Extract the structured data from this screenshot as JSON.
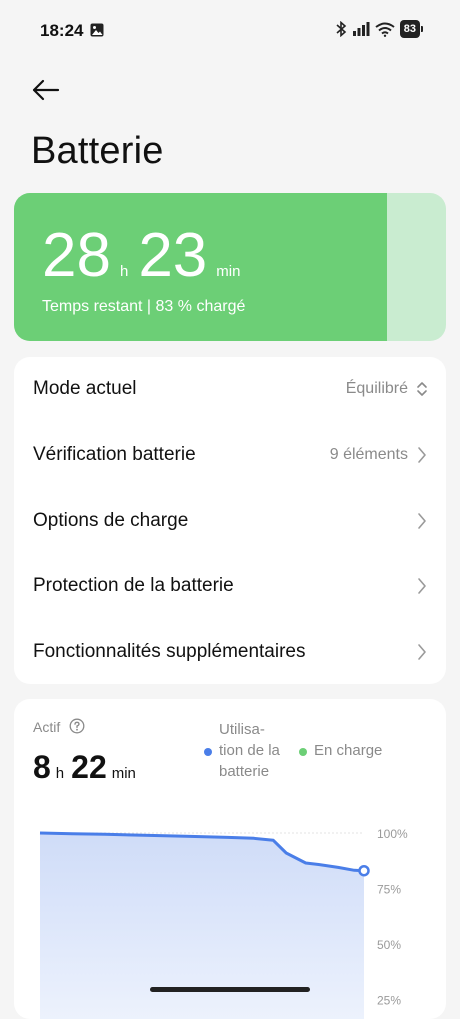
{
  "status": {
    "time": "18:24",
    "battery_level": "83",
    "icons": [
      "image-icon",
      "bluetooth-icon",
      "signal-icon",
      "wifi-icon",
      "battery-icon"
    ]
  },
  "header": {
    "title": "Batterie",
    "back_icon": "arrow-left-icon"
  },
  "hero": {
    "hours": "28",
    "hours_unit": "h",
    "minutes": "23",
    "minutes_unit": "min",
    "subtitle": "Temps restant | 83 % chargé",
    "charge_fraction": 0.83,
    "fill_color": "#6ccf76",
    "track_color": "#c9ecd0"
  },
  "settings": [
    {
      "label": "Mode actuel",
      "value": "Équilibré",
      "icon": "updown-chevron-icon"
    },
    {
      "label": "Vérification batterie",
      "value": "9 éléments",
      "icon": "chevron-right-icon"
    },
    {
      "label": "Options de charge",
      "value": "",
      "icon": "chevron-right-icon"
    },
    {
      "label": "Protection de la batterie",
      "value": "",
      "icon": "chevron-right-icon"
    },
    {
      "label": "Fonctionnalités supplémentaires",
      "value": "",
      "icon": "chevron-right-icon"
    }
  ],
  "activity": {
    "label": "Actif",
    "hours": "8",
    "hours_unit": "h",
    "minutes": "22",
    "minutes_unit": "min",
    "legend": [
      {
        "line1": "Utilisa-",
        "line2": "tion de la",
        "line3": "batterie",
        "color": "#4a7ee8"
      },
      {
        "line1": "En charge",
        "color": "#6ccf76"
      }
    ]
  },
  "chart_data": {
    "type": "area",
    "y_tick_labels": [
      "100%",
      "75%",
      "50%",
      "25%"
    ],
    "ylim": [
      0,
      100
    ],
    "series": [
      {
        "name": "Utilisation de la batterie",
        "values": [
          100,
          99.7,
          99.4,
          99.0,
          98.5,
          98.0,
          97.6,
          96.7,
          91,
          86.5,
          85.8,
          84.5,
          83.2,
          83
        ]
      }
    ],
    "grid": true
  }
}
